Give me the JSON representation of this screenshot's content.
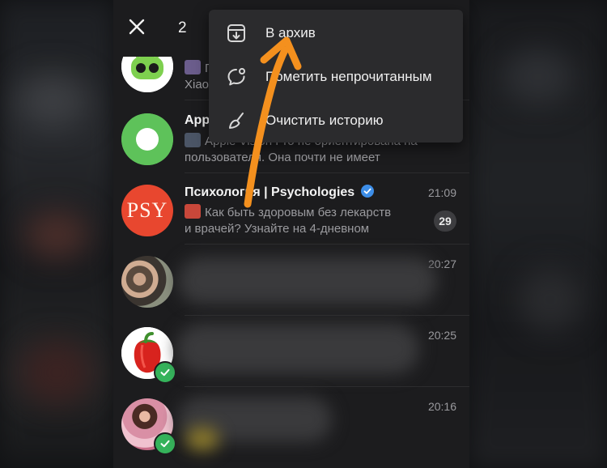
{
  "selection": {
    "count": "2"
  },
  "context_menu": {
    "items": [
      {
        "label": "В архив",
        "icon": "archive-icon"
      },
      {
        "label": "Пометить непрочитанным",
        "icon": "mark-unread-icon"
      },
      {
        "label": "Очистить историю",
        "icon": "clear-history-icon"
      }
    ]
  },
  "chats": [
    {
      "title": "",
      "time": "",
      "preview_line1": "П",
      "preview_line2": "Xiao",
      "unread": "",
      "selected": false,
      "avatar": "android-avatar"
    },
    {
      "title": "App",
      "time": "",
      "preview_line1": "Apple Vision Pro не ориентирована на",
      "preview_line2": "пользователя. Она почти не имеет",
      "unread": "",
      "selected": false,
      "avatar": "green-ring-avatar"
    },
    {
      "title": "Психология | Psychologies",
      "time": "21:09",
      "preview_line1": "Как быть здоровым без лекарств",
      "preview_line2": "и врачей? Узнайте на 4-дневном",
      "unread": "29",
      "selected": false,
      "verified": true,
      "avatar": "psy-avatar",
      "avatar_text": "PSY"
    },
    {
      "title": "",
      "time": "20:27",
      "preview_line1": "",
      "preview_line2": "",
      "unread": "",
      "selected": false,
      "avatar": "group-photo-avatar"
    },
    {
      "title": "",
      "time": "20:25",
      "preview_line1": "",
      "preview_line2": "",
      "unread": "",
      "selected": true,
      "avatar": "pepper-avatar"
    },
    {
      "title": "",
      "time": "20:16",
      "preview_line1": "",
      "preview_line2": "",
      "unread": "",
      "selected": true,
      "avatar": "woman-photo-avatar"
    }
  ],
  "colors": {
    "background": "#1c1c1e",
    "menu": "#2b2b2d",
    "accent_arrow": "#f4901e",
    "check": "#35b35b",
    "psy_red": "#e8472f",
    "verified_blue": "#3d8ee8",
    "android_green": "#7ed04f"
  }
}
